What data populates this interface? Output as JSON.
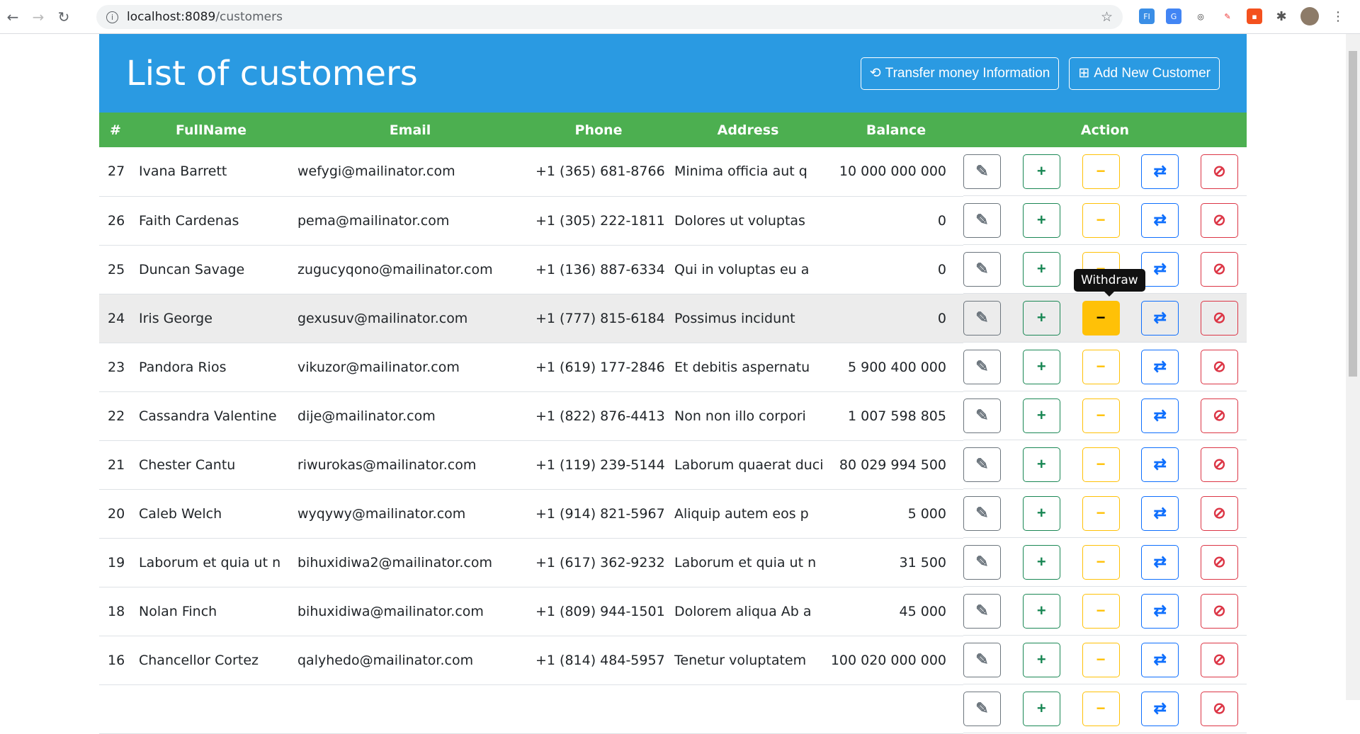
{
  "browser": {
    "url_host": "localhost:8089",
    "url_path": "/customers"
  },
  "header": {
    "title": "List of customers",
    "transfer_info_label": "Transfer money Information",
    "add_customer_label": "Add New Customer"
  },
  "table": {
    "columns": [
      "#",
      "FullName",
      "Email",
      "Phone",
      "Address",
      "Balance",
      "Action"
    ],
    "rows": [
      {
        "id": "27",
        "name": "Ivana Barrett",
        "email": "wefygi@mailinator.com",
        "phone": "+1 (365) 681-8766",
        "address": "Minima officia aut q",
        "balance": "10 000 000 000"
      },
      {
        "id": "26",
        "name": "Faith Cardenas",
        "email": "pema@mailinator.com",
        "phone": "+1 (305) 222-1811",
        "address": "Dolores ut voluptas",
        "balance": "0"
      },
      {
        "id": "25",
        "name": "Duncan Savage",
        "email": "zugucyqono@mailinator.com",
        "phone": "+1 (136) 887-6334",
        "address": "Qui in voluptas eu a",
        "balance": "0"
      },
      {
        "id": "24",
        "name": "Iris George",
        "email": "gexusuv@mailinator.com",
        "phone": "+1 (777) 815-6184",
        "address": "Possimus incidunt",
        "balance": "0"
      },
      {
        "id": "23",
        "name": "Pandora Rios",
        "email": "vikuzor@mailinator.com",
        "phone": "+1 (619) 177-2846",
        "address": "Et debitis aspernatu",
        "balance": "5 900 400 000"
      },
      {
        "id": "22",
        "name": "Cassandra Valentine",
        "email": "dije@mailinator.com",
        "phone": "+1 (822) 876-4413",
        "address": "Non non illo corpori",
        "balance": "1 007 598 805"
      },
      {
        "id": "21",
        "name": "Chester Cantu",
        "email": "riwurokas@mailinator.com",
        "phone": "+1 (119) 239-5144",
        "address": "Laborum quaerat duci",
        "balance": "80 029 994 500"
      },
      {
        "id": "20",
        "name": "Caleb Welch",
        "email": "wyqywy@mailinator.com",
        "phone": "+1 (914) 821-5967",
        "address": "Aliquip autem eos p",
        "balance": "5 000"
      },
      {
        "id": "19",
        "name": "Laborum et quia ut n",
        "email": "bihuxidiwa2@mailinator.com",
        "phone": "+1 (617) 362-9232",
        "address": "Laborum et quia ut n",
        "balance": "31 500"
      },
      {
        "id": "18",
        "name": "Nolan Finch",
        "email": "bihuxidiwa@mailinator.com",
        "phone": "+1 (809) 944-1501",
        "address": "Dolorem aliqua Ab a",
        "balance": "45 000"
      },
      {
        "id": "16",
        "name": "Chancellor Cortez",
        "email": "qalyhedo@mailinator.com",
        "phone": "+1 (814) 484-5957",
        "address": "Tenetur voluptatem",
        "balance": "100 020 000 000"
      },
      {
        "id": "",
        "name": "",
        "email": "",
        "phone": "",
        "address": "",
        "balance": ""
      }
    ]
  },
  "tooltip": {
    "text": "Withdraw"
  },
  "colors": {
    "header": "#2a9ae2",
    "table_header": "#4caf50"
  }
}
